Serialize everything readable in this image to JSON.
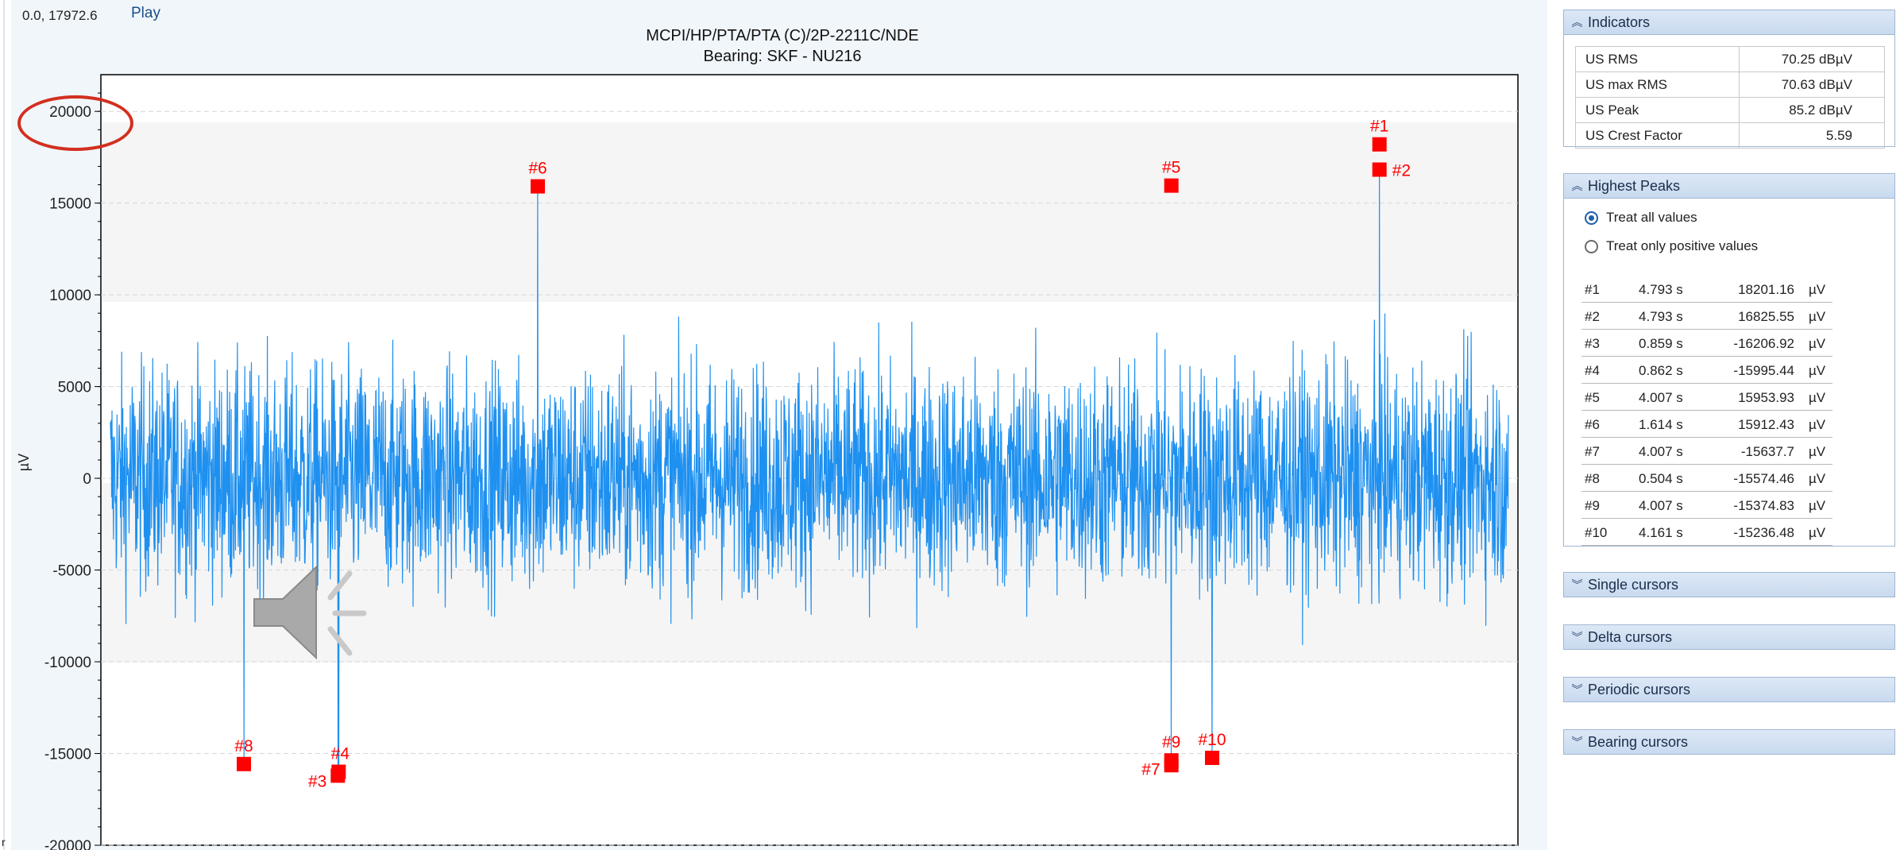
{
  "toolbar": {
    "coords": "0.0, 17972.6",
    "play_label": "Play"
  },
  "chart": {
    "title_line1": "MCPI/HP/PTA/PTA (C)/2P-2211C/NDE",
    "title_line2": "Bearing: SKF - NU216",
    "y_axis_label": "µV",
    "y_ticks": [
      "20000",
      "15000",
      "10000",
      "5000",
      "0",
      "-5000",
      "-10000",
      "-15000",
      "-20000"
    ]
  },
  "chart_data": {
    "type": "line",
    "title": "MCPI/HP/PTA/PTA (C)/2P-2211C/NDE",
    "subtitle": "Bearing: SKF - NU216",
    "ylabel": "µV",
    "xlabel": "",
    "ylim": [
      -20000,
      22000
    ],
    "xlim": [
      0,
      5.28
    ],
    "grid": true,
    "line_color": "#1e90f0",
    "marker_color": "#ff0000",
    "peaks": [
      {
        "id": "#1",
        "x": 4.793,
        "y": 18201.16
      },
      {
        "id": "#2",
        "x": 4.793,
        "y": 16825.55
      },
      {
        "id": "#3",
        "x": 0.859,
        "y": -16206.92
      },
      {
        "id": "#4",
        "x": 0.862,
        "y": -15995.44
      },
      {
        "id": "#5",
        "x": 4.007,
        "y": 15953.93
      },
      {
        "id": "#6",
        "x": 1.614,
        "y": 15912.43
      },
      {
        "id": "#7",
        "x": 4.007,
        "y": -15637.7
      },
      {
        "id": "#8",
        "x": 0.504,
        "y": -15574.46
      },
      {
        "id": "#9",
        "x": 4.007,
        "y": -15374.83
      },
      {
        "id": "#10",
        "x": 4.161,
        "y": -15236.48
      }
    ]
  },
  "panel": {
    "indicators": {
      "title": "Indicators",
      "rows": [
        {
          "label": "US RMS",
          "value": "70.25 dBµV"
        },
        {
          "label": "US max RMS",
          "value": "70.63 dBµV"
        },
        {
          "label": "US Peak",
          "value": "85.2 dBµV"
        },
        {
          "label": "US Crest Factor",
          "value": "5.59"
        }
      ]
    },
    "highest_peaks": {
      "title": "Highest Peaks",
      "option_all": "Treat all values",
      "option_positive": "Treat only positive values",
      "rows": [
        {
          "id": "#1",
          "time": "4.793 s",
          "value": "18201.16",
          "unit": "µV"
        },
        {
          "id": "#2",
          "time": "4.793 s",
          "value": "16825.55",
          "unit": "µV"
        },
        {
          "id": "#3",
          "time": "0.859 s",
          "value": "-16206.92",
          "unit": "µV"
        },
        {
          "id": "#4",
          "time": "0.862 s",
          "value": "-15995.44",
          "unit": "µV"
        },
        {
          "id": "#5",
          "time": "4.007 s",
          "value": "15953.93",
          "unit": "µV"
        },
        {
          "id": "#6",
          "time": "1.614 s",
          "value": "15912.43",
          "unit": "µV"
        },
        {
          "id": "#7",
          "time": "4.007 s",
          "value": "-15637.7",
          "unit": "µV"
        },
        {
          "id": "#8",
          "time": "0.504 s",
          "value": "-15574.46",
          "unit": "µV"
        },
        {
          "id": "#9",
          "time": "4.007 s",
          "value": "-15374.83",
          "unit": "µV"
        },
        {
          "id": "#10",
          "time": "4.161 s",
          "value": "-15236.48",
          "unit": "µV"
        }
      ]
    },
    "collapsed_sections": [
      "Single cursors",
      "Delta cursors",
      "Periodic cursors",
      "Bearing cursors"
    ]
  }
}
